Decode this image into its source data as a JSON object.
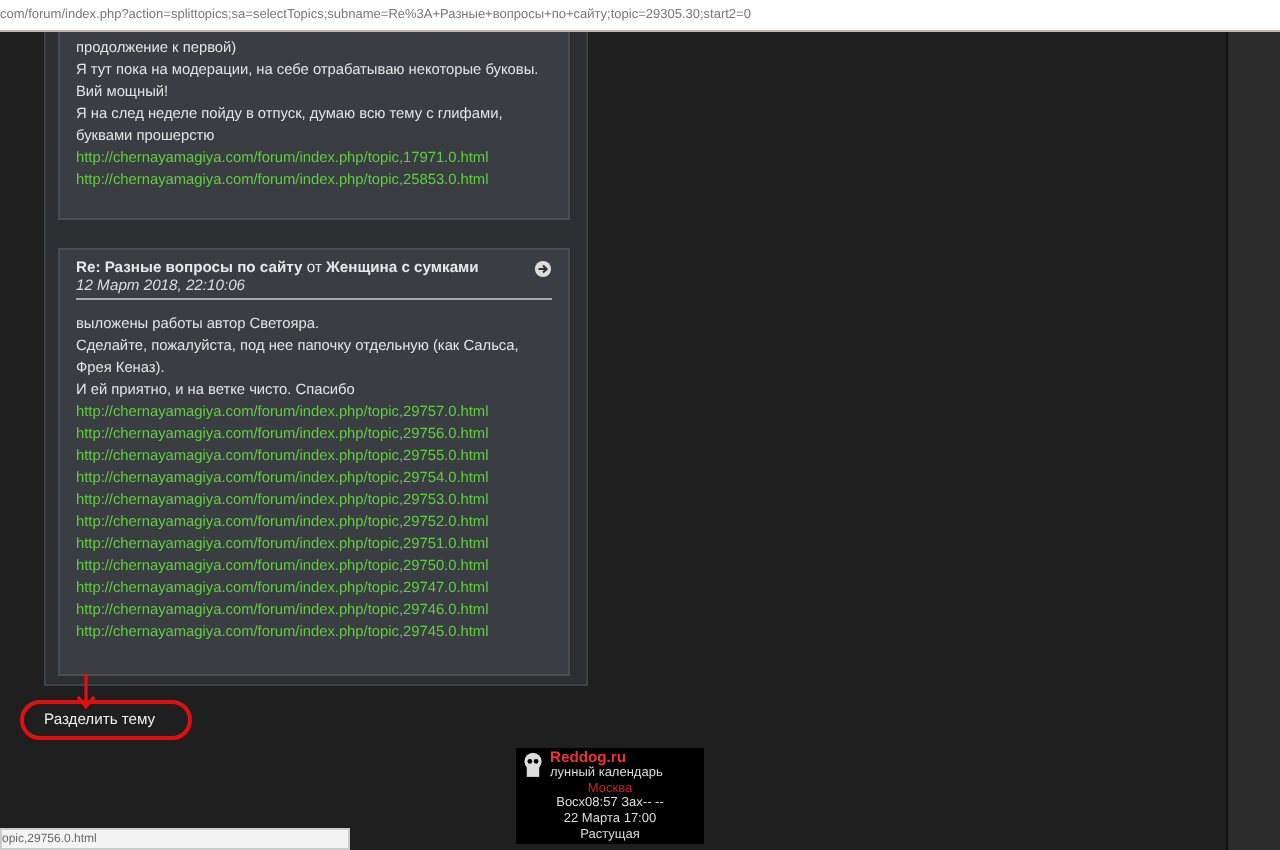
{
  "address_bar": {
    "url": "com/forum/index.php?action=splittopics;sa=selectTopics;subname=Re%3A+Разные+вопросы+по+сайту;topic=29305.30;start2=0"
  },
  "posts": [
    {
      "lines": [
        "продолжение к первой)",
        "Я тут пока на модерации, на себе отрабатываю  некоторые буковы.",
        "Вий мощный!",
        "Я на след неделе пойду в отпуск, думаю всю тему с глифами, буквами прошерстю"
      ],
      "links": [
        "http://chernayamagiya.com/forum/index.php/topic,17971.0.html",
        "http://chernayamagiya.com/forum/index.php/topic,25853.0.html"
      ]
    },
    {
      "title": "**Re: Разные вопросы по сайту** от **Женщина с сумками**",
      "date": "12 Март 2018, 22:10:06",
      "lines": [
        "выложены работы автор Светояра.",
        "Сделайте, пожалуйста,  под  нее папочку отдельную (как Сальса, Фрея Кеназ).",
        "И ей приятно, и на ветке чисто.  Спасибо"
      ],
      "links": [
        "http://chernayamagiya.com/forum/index.php/topic,29757.0.html",
        "http://chernayamagiya.com/forum/index.php/topic,29756.0.html",
        "http://chernayamagiya.com/forum/index.php/topic,29755.0.html",
        "http://chernayamagiya.com/forum/index.php/topic,29754.0.html",
        "http://chernayamagiya.com/forum/index.php/topic,29753.0.html",
        "http://chernayamagiya.com/forum/index.php/topic,29752.0.html",
        "http://chernayamagiya.com/forum/index.php/topic,29751.0.html",
        "http://chernayamagiya.com/forum/index.php/topic,29750.0.html",
        "http://chernayamagiya.com/forum/index.php/topic,29747.0.html",
        "http://chernayamagiya.com/forum/index.php/topic,29746.0.html",
        "http://chernayamagiya.com/forum/index.php/topic,29745.0.html"
      ]
    }
  ],
  "split_button": {
    "label": "Разделить тему"
  },
  "widget": {
    "site": "Reddog.ru",
    "subtitle": "лунный календарь",
    "city": "Москва",
    "times": "Восх08:57 Зах-- --",
    "date": "22 Марта 17:00",
    "phase": "Растущая"
  },
  "status_bar": {
    "text": "opic,29756.0.html"
  }
}
